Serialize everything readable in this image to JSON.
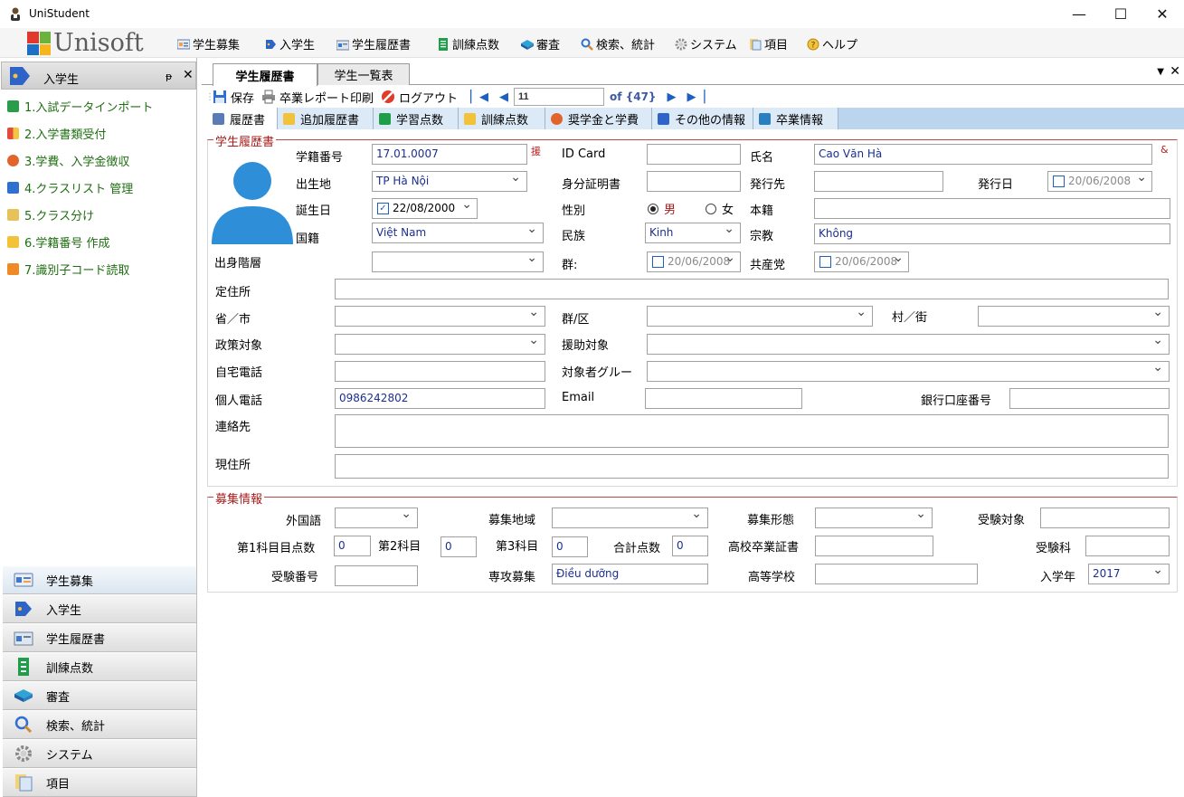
{
  "window": {
    "title": "UniStudent"
  },
  "menubar": {
    "logo_text": "Unisoft",
    "items": [
      "学生募集",
      "入学生",
      "学生履歴書",
      "訓練点数",
      "審査",
      "検索、統計",
      "システム",
      "項目",
      "ヘルプ"
    ]
  },
  "sidebar": {
    "header": "入学生",
    "pin_glyph": "ᵽ",
    "items": [
      "1.入試データインポート",
      "2.入学書類受付",
      "3.学費、入学金徴収",
      "4.クラスリスト 管理",
      "5.クラス分け",
      "6.学籍番号 作成",
      "7.識別子コード読取"
    ],
    "bottom": [
      "学生募集",
      "入学生",
      "学生履歴書",
      "訓練点数",
      "審査",
      "検索、統計",
      "システム",
      "項目"
    ]
  },
  "doc_tabs": [
    "学生履歴書",
    "学生一覧表"
  ],
  "toolbar": {
    "save": "保存",
    "print": "卒業レポート印刷",
    "logout": "ログアウト",
    "page_value": "11",
    "page_of": "of {47}"
  },
  "form_tabs": [
    "履歴書",
    "追加履歴書",
    "学習点数",
    "訓練点数",
    "奨学金と学費",
    "その他の情報",
    "卒業情報"
  ],
  "profile": {
    "group_title": "学生履歴書",
    "labels": {
      "student_id": "学籍番号",
      "id_card": "ID Card",
      "name": "氏名",
      "birthplace": "出生地",
      "id_doc": "身分証明書",
      "issuer": "発行先",
      "issue_date": "発行日",
      "dob": "誕生日",
      "gender": "性別",
      "hometown": "本籍",
      "nationality": "国籍",
      "ethnicity": "民族",
      "religion": "宗教",
      "social_class": "出身階層",
      "group": "群:",
      "party": "共産党",
      "residence": "定住所",
      "province": "省／市",
      "district": "群/区",
      "ward": "村／街",
      "policy": "政策対象",
      "support": "援助対象",
      "home_phone": "自宅電話",
      "target_group": "対象者グルー",
      "mobile": "個人電話",
      "email": "Email",
      "bank": "銀行口座番号",
      "contact": "連絡先",
      "current_address": "現住所"
    },
    "values": {
      "student_id": "17.01.0007",
      "student_id_mark": "援",
      "name": "Cao Văn Hà",
      "name_mark": "&",
      "birthplace": "TP Hà Nội",
      "issue_date": "20/06/2008",
      "dob": "22/08/2000",
      "gender_male": "男",
      "gender_female": "女",
      "nationality": "Việt Nam",
      "ethnicity": "Kinh",
      "religion": "Không",
      "group_date": "20/06/2008",
      "party_date": "20/06/2008",
      "mobile": "0986242802"
    }
  },
  "recruit": {
    "group_title": "募集情報",
    "labels": {
      "language": "外国語",
      "region": "募集地域",
      "form": "募集形態",
      "target": "受験対象",
      "subj1": "第1科目目点数",
      "subj2": "第2科目",
      "subj3": "第3科目",
      "total": "合計点数",
      "hs_cert": "高校卒業証書",
      "exam_subject": "受験科",
      "exam_no": "受験番号",
      "major": "専攻募集",
      "high_school": "高等学校",
      "enroll_year": "入学年"
    },
    "values": {
      "subj1": "0",
      "subj2": "0",
      "subj3": "0",
      "total": "0",
      "major": "Điều dưỡng",
      "enroll_year": "2017"
    }
  }
}
